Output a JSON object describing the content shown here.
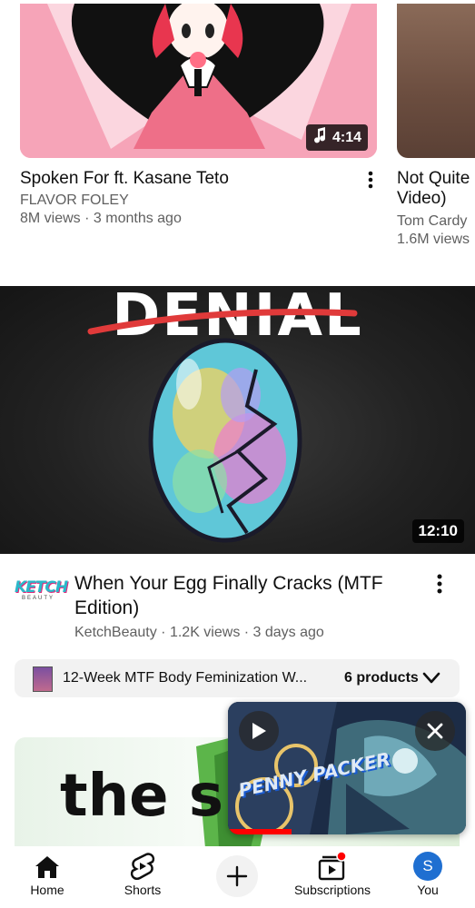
{
  "feed": {
    "shelf": [
      {
        "title": "Spoken For ft. Kasane Teto",
        "channel": "FLAVOR FOLEY",
        "meta": "8M views · 3 months ago",
        "duration": "4:14",
        "duration_icon": "music-note-icon"
      },
      {
        "title_line1": "Not Quite ",
        "title_line2": "Video)",
        "channel": "Tom Cardy",
        "meta": "1.6M views"
      }
    ],
    "main_video": {
      "thumb_text": "DENIAL",
      "duration": "12:10",
      "channel_logo_text": "KETCH",
      "channel_logo_sub": "BEAUTY",
      "title": "When Your Egg Finally Cracks (MTF Edition)",
      "meta": "KetchBeauty · 1.2K views · 3 days ago"
    },
    "product_shelf": {
      "label": "12-Week MTF Body Feminization W...",
      "count": "6 products"
    },
    "next_video": {
      "thumb_text": "the s"
    }
  },
  "mini_player": {
    "overlay_text": "PENNY PACKER"
  },
  "bottom_nav": {
    "items": [
      {
        "label": "Home",
        "icon": "home-icon"
      },
      {
        "label": "Shorts",
        "icon": "shorts-icon"
      },
      {
        "label": "",
        "icon": "create-icon"
      },
      {
        "label": "Subscriptions",
        "icon": "subscriptions-icon"
      },
      {
        "label": "You",
        "icon": "avatar",
        "avatar_letter": "S"
      }
    ]
  },
  "colors": {
    "accent_red": "#ff0000",
    "avatar_blue": "#1f6fd1",
    "text_secondary": "#606060"
  }
}
